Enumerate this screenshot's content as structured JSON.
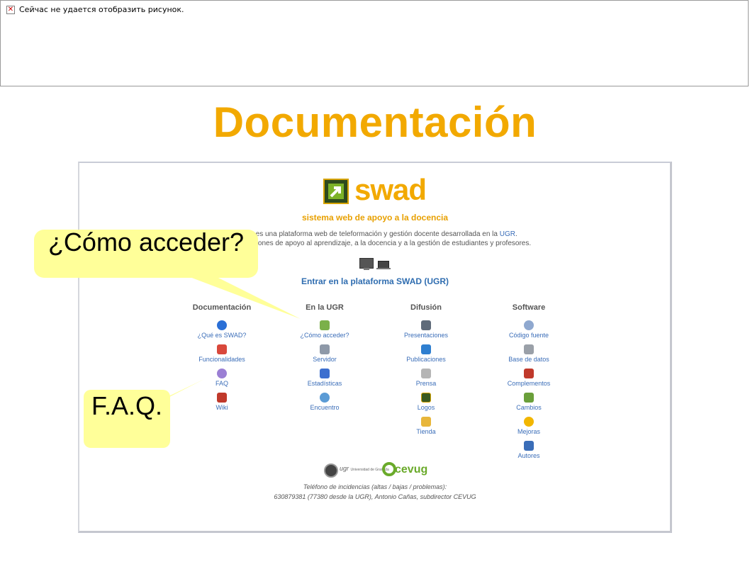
{
  "broken_image": {
    "message": "Сейчас не удается отобразить рисунок."
  },
  "slide": {
    "title": "Documentación"
  },
  "swad": {
    "logo_text": "swad",
    "tagline": "sistema web de apoyo a la docencia",
    "desc_line1": "SWAD es una plataforma web de teleformación y gestión docente desarrollada en la",
    "desc_link": "UGR",
    "desc_line1_end": ".",
    "desc_line2": "Integra funciones de apoyo al aprendizaje, a la docencia y a la gestión de estudiantes y profesores.",
    "enter_link": "Entrar en la plataforma SWAD (UGR)",
    "columns": [
      {
        "title": "Documentación",
        "items": [
          {
            "label": "¿Qué es SWAD?",
            "icon": "info-icon",
            "color": "#2a6fd6"
          },
          {
            "label": "Funcionalidades",
            "icon": "blocks-icon",
            "color": "#d9483b"
          },
          {
            "label": "FAQ",
            "icon": "chat-icon",
            "color": "#9b7fd4"
          },
          {
            "label": "Wiki",
            "icon": "books-icon",
            "color": "#c0392b"
          }
        ]
      },
      {
        "title": "En la UGR",
        "items": [
          {
            "label": "¿Cómo acceder?",
            "icon": "users-key-icon",
            "color": "#7bb04a"
          },
          {
            "label": "Servidor",
            "icon": "server-icon",
            "color": "#8e99a8"
          },
          {
            "label": "Estadísticas",
            "icon": "stats-icon",
            "color": "#3d6fcf"
          },
          {
            "label": "Encuentro",
            "icon": "people-icon",
            "color": "#5b9bd5"
          }
        ]
      },
      {
        "title": "Difusión",
        "items": [
          {
            "label": "Presentaciones",
            "icon": "presentation-icon",
            "color": "#5f6b7a"
          },
          {
            "label": "Publicaciones",
            "icon": "book-icon",
            "color": "#2f7fd0"
          },
          {
            "label": "Prensa",
            "icon": "press-icon",
            "color": "#b5b5b5"
          },
          {
            "label": "Logos",
            "icon": "swad-logo-icon",
            "color": "#3b5a20"
          },
          {
            "label": "Tienda",
            "icon": "cup-icon",
            "color": "#e8b63a"
          }
        ]
      },
      {
        "title": "Software",
        "items": [
          {
            "label": "Código fuente",
            "icon": "cd-icon",
            "color": "#8fa8cf"
          },
          {
            "label": "Base de datos",
            "icon": "database-icon",
            "color": "#9aa0a8"
          },
          {
            "label": "Complementos",
            "icon": "plugin-icon",
            "color": "#c0392b"
          },
          {
            "label": "Cambios",
            "icon": "changes-icon",
            "color": "#6a9f3a"
          },
          {
            "label": "Mejoras",
            "icon": "bulb-icon",
            "color": "#f2b600"
          },
          {
            "label": "Autores",
            "icon": "author-icon",
            "color": "#3a6db8"
          }
        ]
      }
    ],
    "footer_ugr": "ugr",
    "footer_ugr_small": "Universidad de Granada",
    "footer_cevug": "cevug",
    "footer_line1": "Teléfono de incidencias (altas / bajas / problemas):",
    "footer_line2": "630879381 (77380 desde la UGR), Antonio Cañas, subdirector CEVUG"
  },
  "callouts": {
    "como_acceder": "¿Cómo acceder?",
    "faq": "F.A.Q."
  },
  "colors": {
    "title": "#f2a900",
    "callout_bg": "#ffff99",
    "link": "#2f6db0"
  }
}
